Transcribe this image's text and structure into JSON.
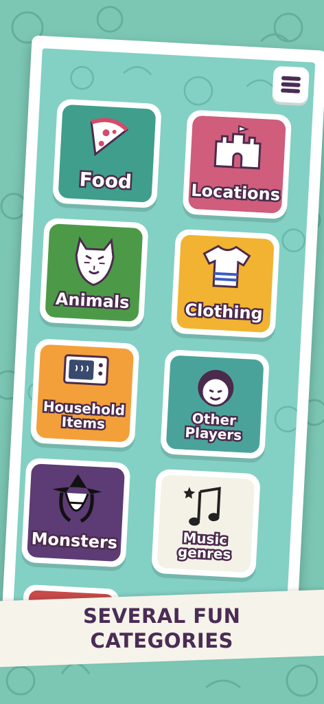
{
  "menu": {
    "icon": "hamburger-icon"
  },
  "categories": [
    {
      "label": "Food",
      "color": "#3f9e8c",
      "icon": "pizza-icon"
    },
    {
      "label": "Locations",
      "color": "#cf5d7b",
      "icon": "castle-icon"
    },
    {
      "label": "Animals",
      "color": "#4c9a48",
      "icon": "tiger-icon"
    },
    {
      "label": "Clothing",
      "color": "#f1b331",
      "icon": "tshirt-icon"
    },
    {
      "label": "Household Items",
      "color": "#f3a03a",
      "icon": "microwave-icon"
    },
    {
      "label": "Other Players",
      "color": "#4aa39a",
      "icon": "player-face-icon"
    },
    {
      "label": "Monsters",
      "color": "#5d3b74",
      "icon": "witch-icon"
    },
    {
      "label": "Music genres",
      "color": "#f4f2e6",
      "icon": "music-notes-icon"
    }
  ],
  "caption": {
    "line1": "SEVERAL FUN",
    "line2": "CATEGORIES"
  }
}
